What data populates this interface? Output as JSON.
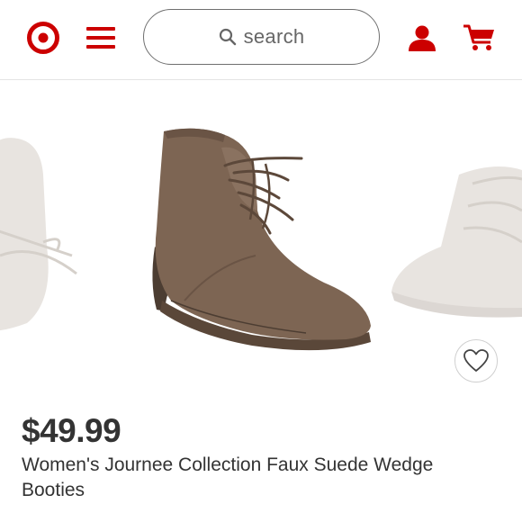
{
  "header": {
    "logo_icon": "target-bullseye-icon",
    "menu_icon": "hamburger-menu-icon",
    "search": {
      "icon": "search-icon",
      "placeholder": "search"
    },
    "account_icon": "user-icon",
    "cart_icon": "cart-icon"
  },
  "carousel": {
    "images": [
      "shoe-image-previous",
      "shoe-image-current",
      "shoe-image-next"
    ]
  },
  "product": {
    "price": "$49.99",
    "title": "Women's Journee Collection Faux Suede Wedge Booties",
    "favorite_icon": "heart-icon"
  },
  "colors": {
    "brand_red": "#cc0000",
    "text": "#333333",
    "suede_brown": "#7d6553"
  }
}
